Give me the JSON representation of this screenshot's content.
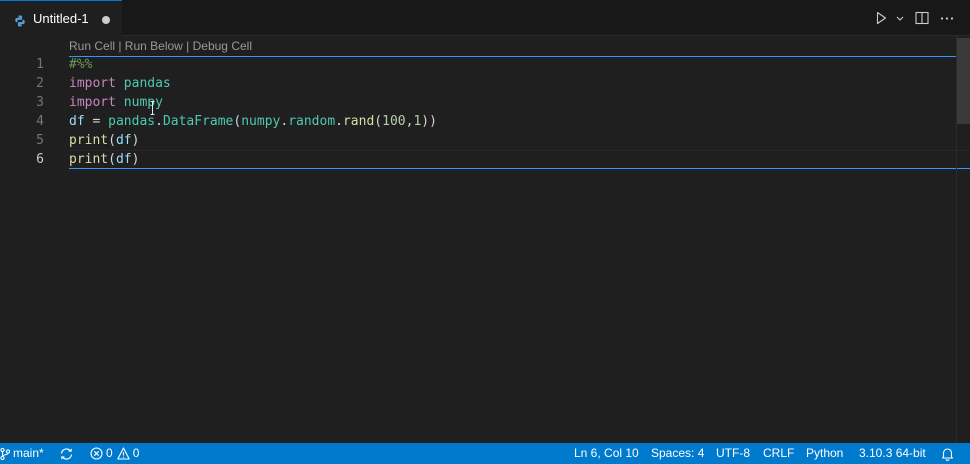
{
  "tab": {
    "title": "Untitled-1",
    "dirty": true
  },
  "editor": {
    "codelens": "Run Cell | Run Below | Debug Cell",
    "line_numbers": [
      "1",
      "2",
      "3",
      "4",
      "5",
      "6"
    ],
    "active_line": 6
  },
  "code": {
    "l1": {
      "comment": "#%%"
    },
    "l2": {
      "kw": "import",
      "mod": "pandas"
    },
    "l3": {
      "kw": "import",
      "mod": "numpy"
    },
    "l4": {
      "var1": "df",
      "eq": " = ",
      "mod1": "pandas",
      "dot1": ".",
      "fn1": "DataFrame",
      "p1": "(",
      "mod2": "numpy",
      "dot2": ".",
      "attr": "random",
      "dot3": ".",
      "fn2": "rand",
      "p2": "(",
      "n1": "100",
      "comma": ",",
      "n2": "1",
      "p3": "))"
    },
    "l5": {
      "fn": "print",
      "p1": "(",
      "arg": "df",
      "p2": ")"
    },
    "l6": {
      "fn": "print",
      "p1": "(",
      "arg": "df",
      "p2": ")"
    }
  },
  "statusbar": {
    "branch": "main*",
    "errors": "0",
    "warnings": "0",
    "position": "Ln 6, Col 10",
    "indent": "Spaces: 4",
    "encoding": "UTF-8",
    "eol": "CRLF",
    "language": "Python",
    "interpreter": "3.10.3 64-bit"
  },
  "icons": {
    "tab_file": "python-icon",
    "run": "play-icon",
    "run_menu": "chevron-down-icon",
    "split": "split-editor-icon",
    "more": "ellipsis-icon",
    "branch": "git-branch-icon",
    "sync": "sync-icon",
    "errors": "error-icon",
    "warnings": "warning-icon",
    "notifications": "bell-icon"
  },
  "colors": {
    "accent": "#3794ff",
    "statusbar": "#007acc",
    "background": "#1f1f1f"
  }
}
